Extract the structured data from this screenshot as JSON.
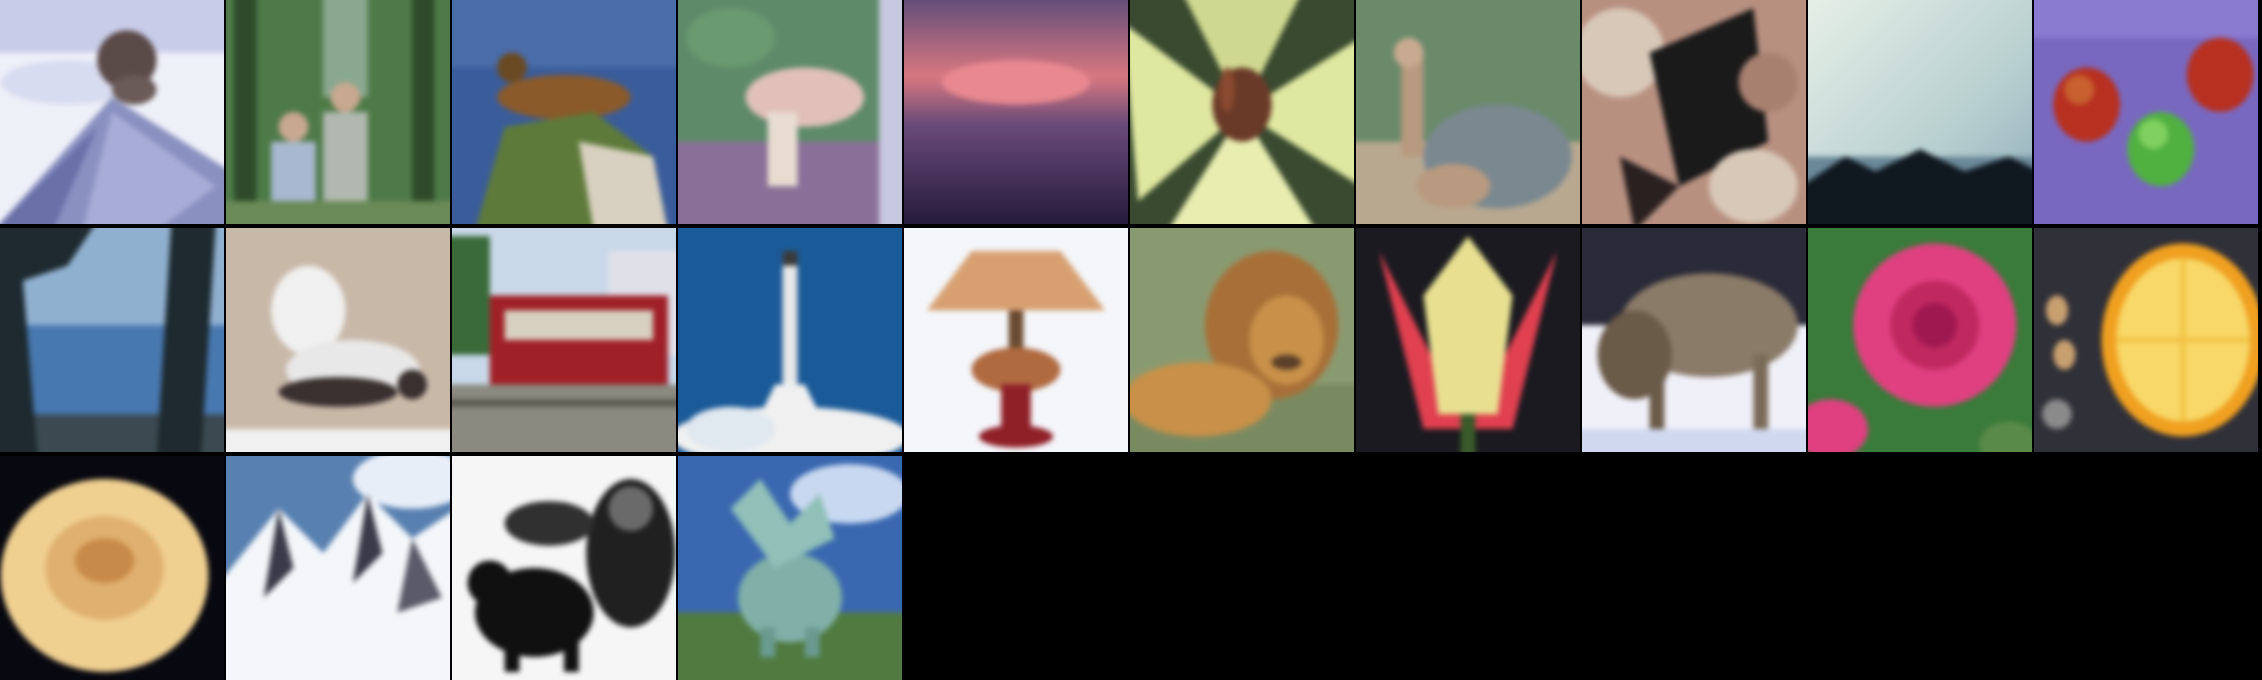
{
  "grid": {
    "columns": 10,
    "rows": 3,
    "background": "#000000"
  },
  "tiles": [
    {
      "subject": "volcano",
      "colors": [
        "#eef0f8",
        "#8a90c0",
        "#5a4a48"
      ]
    },
    {
      "subject": "people-in-forest",
      "colors": [
        "#4e7a48",
        "#a8b8b0",
        "#2e4a2a"
      ]
    },
    {
      "subject": "seal-on-rock",
      "colors": [
        "#3a5c9a",
        "#8a5a2a",
        "#5e7a3a"
      ]
    },
    {
      "subject": "mushroom",
      "colors": [
        "#5e8a6a",
        "#e0c0b8",
        "#8a7098"
      ]
    },
    {
      "subject": "sunset-sky",
      "colors": [
        "#d87880",
        "#4a3a6a",
        "#201838"
      ]
    },
    {
      "subject": "lily-flower",
      "colors": [
        "#dfe8a0",
        "#6a3a28",
        "#3a4a30"
      ]
    },
    {
      "subject": "camel",
      "colors": [
        "#7a8890",
        "#b89a80",
        "#6a8a6a"
      ]
    },
    {
      "subject": "lobster",
      "colors": [
        "#b89080",
        "#1a1a1a",
        "#d8c8b8"
      ]
    },
    {
      "subject": "cloudy-plain",
      "colors": [
        "#e8f0e8",
        "#8aa8b8",
        "#101820"
      ]
    },
    {
      "subject": "apples",
      "colors": [
        "#7868c0",
        "#b83020",
        "#50b040"
      ]
    },
    {
      "subject": "sea-through-trees",
      "colors": [
        "#4878b0",
        "#1e2a30",
        "#90b0d0"
      ]
    },
    {
      "subject": "skunk",
      "colors": [
        "#c8b8a8",
        "#f0f0f0",
        "#3a3030"
      ]
    },
    {
      "subject": "streetcar",
      "colors": [
        "#a02028",
        "#c8d8e8",
        "#8a8a80"
      ]
    },
    {
      "subject": "rocket",
      "colors": [
        "#1a5a98",
        "#f0f0f0",
        "#3a3a3a"
      ]
    },
    {
      "subject": "lamp",
      "colors": [
        "#f4f6fa",
        "#d8a070",
        "#902028"
      ]
    },
    {
      "subject": "lion",
      "colors": [
        "#8a9a70",
        "#c89048",
        "#5a4028"
      ]
    },
    {
      "subject": "tulip",
      "colors": [
        "#1a1a20",
        "#e8e090",
        "#e04050"
      ]
    },
    {
      "subject": "wolf",
      "colors": [
        "#f0f0f8",
        "#8a7a68",
        "#3a3a48"
      ]
    },
    {
      "subject": "pink-rose",
      "colors": [
        "#e04080",
        "#3a7a3a",
        "#c02860"
      ]
    },
    {
      "subject": "orange-slice",
      "colors": [
        "#303038",
        "#f0a020",
        "#f8d868"
      ]
    },
    {
      "subject": "yellow-rose",
      "colors": [
        "#080810",
        "#f0d090",
        "#c88a48"
      ]
    },
    {
      "subject": "snowy-mountains",
      "colors": [
        "#5880b0",
        "#f4f6fa",
        "#3a3a48"
      ]
    },
    {
      "subject": "bears",
      "colors": [
        "#f6f6f6",
        "#101010",
        "#6a6a6a"
      ]
    },
    {
      "subject": "dinosaur-statue",
      "colors": [
        "#3a68b0",
        "#80b0a8",
        "#507a40"
      ]
    }
  ]
}
